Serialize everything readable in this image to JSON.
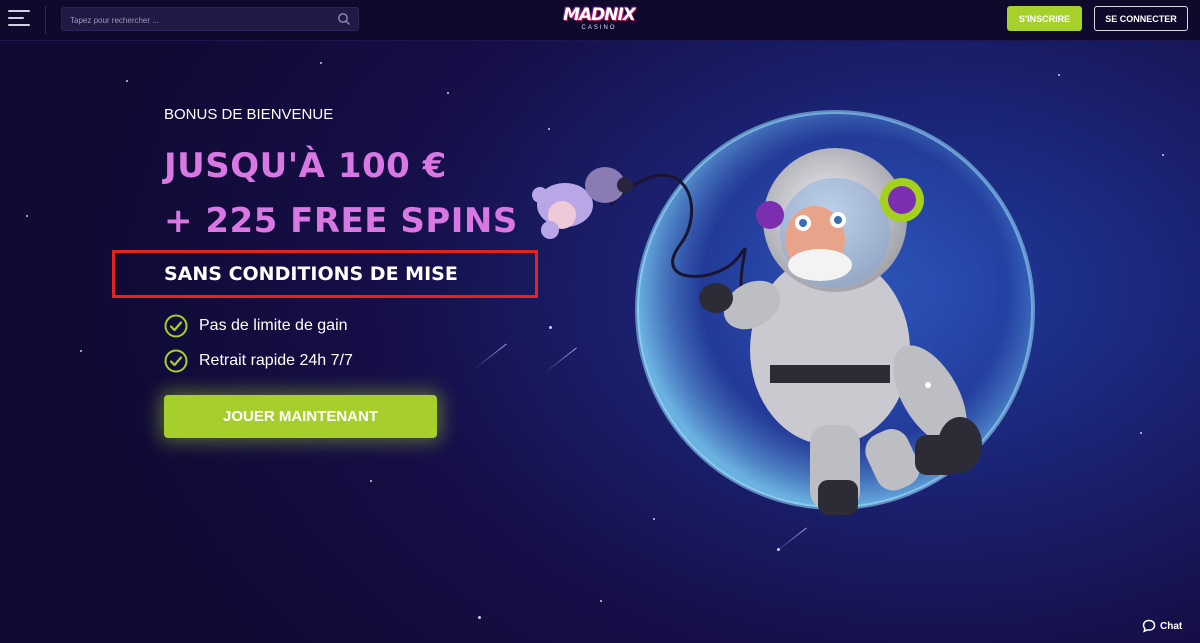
{
  "header": {
    "search_placeholder": "Tapez pour rechercher ...",
    "logo_text": "MADNIX",
    "logo_subtext": "CASINO",
    "signup_label": "S'INSCRIRE",
    "login_label": "SE CONNECTER"
  },
  "hero": {
    "eyebrow": "BONUS DE BIENVENUE",
    "headline_line1": "JUSQU'À 100 €",
    "headline_line2": "+ 225 FREE SPINS",
    "no_wager": "SANS CONDITIONS DE MISE",
    "features": [
      {
        "label": "Pas de limite de gain",
        "icon": "check-circle-icon"
      },
      {
        "label": "Retrait rapide 24h 7/7",
        "icon": "check-circle-icon"
      }
    ],
    "cta_label": "JOUER MAINTENANT"
  },
  "chat": {
    "label": "Chat"
  },
  "colors": {
    "accent_green": "#a6d12a",
    "headline_pink": "#d977e3",
    "highlight_red": "#e1241c",
    "header_bg": "#0f0a2c"
  }
}
